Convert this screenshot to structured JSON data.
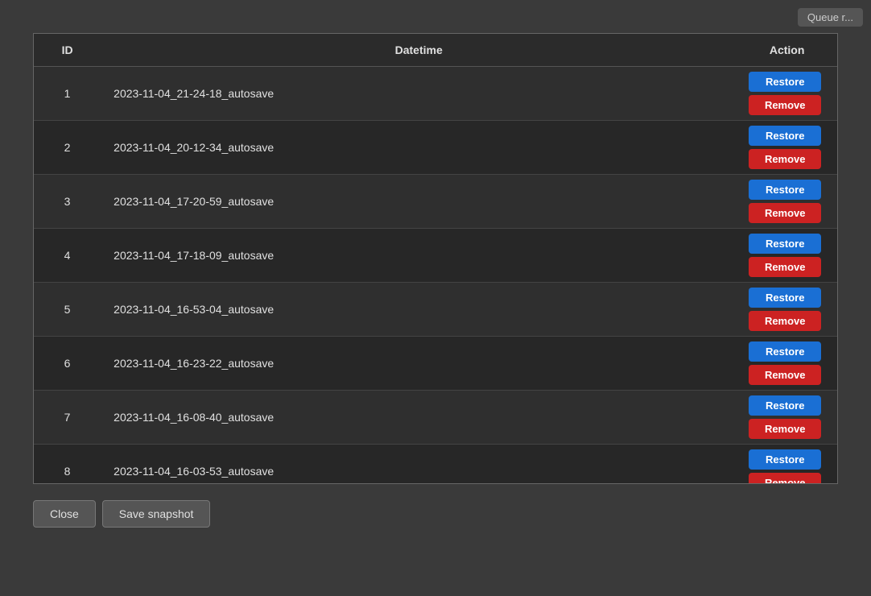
{
  "header": {
    "queue_label": "Queue r..."
  },
  "table": {
    "columns": {
      "id": "ID",
      "datetime": "Datetime",
      "action": "Action"
    },
    "rows": [
      {
        "id": 1,
        "datetime": "2023-11-04_21-24-18_autosave"
      },
      {
        "id": 2,
        "datetime": "2023-11-04_20-12-34_autosave"
      },
      {
        "id": 3,
        "datetime": "2023-11-04_17-20-59_autosave"
      },
      {
        "id": 4,
        "datetime": "2023-11-04_17-18-09_autosave"
      },
      {
        "id": 5,
        "datetime": "2023-11-04_16-53-04_autosave"
      },
      {
        "id": 6,
        "datetime": "2023-11-04_16-23-22_autosave"
      },
      {
        "id": 7,
        "datetime": "2023-11-04_16-08-40_autosave"
      },
      {
        "id": 8,
        "datetime": "2023-11-04_16-03-53_autosave"
      }
    ],
    "restore_label": "Restore",
    "remove_label": "Remove"
  },
  "footer": {
    "close_label": "Close",
    "save_snapshot_label": "Save snapshot"
  }
}
